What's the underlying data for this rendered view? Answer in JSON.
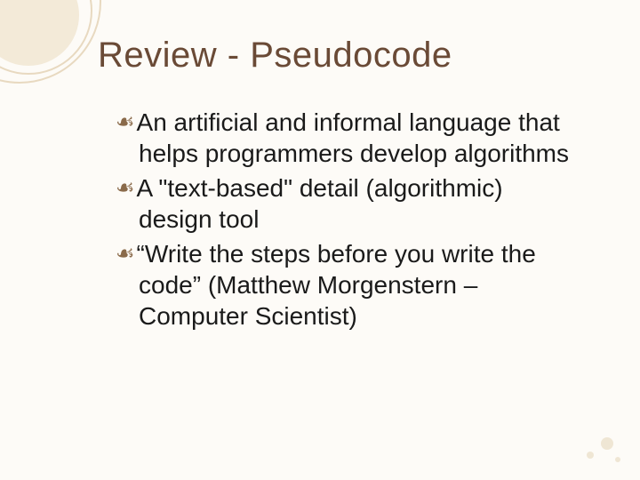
{
  "slide": {
    "title": "Review - Pseudocode",
    "bullet_glyph": "༄",
    "items": [
      "An artificial and informal language that helps programmers develop algorithms",
      "A \"text-based\" detail (algorithmic) design tool",
      "“Write the steps before you write the code” (Matthew Morgenstern – Computer Scientist)"
    ]
  }
}
